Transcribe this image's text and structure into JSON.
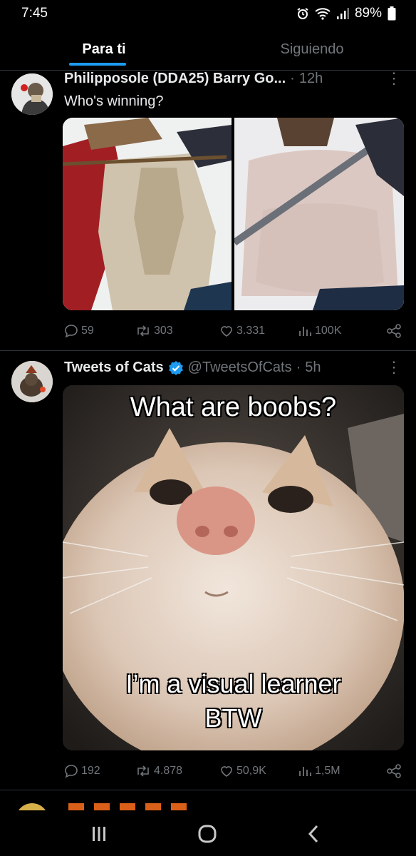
{
  "status_bar": {
    "time": "7:45",
    "battery": "89%",
    "icons": [
      "alarm-icon",
      "wifi-icon",
      "signal-icon",
      "battery-icon"
    ]
  },
  "tabs": [
    {
      "label": "Para ti",
      "active": true
    },
    {
      "label": "Siguiendo",
      "active": false
    }
  ],
  "tweets": [
    {
      "author": "Philipposole (DDA25) Barry Go...",
      "separator": "·",
      "time": "12h",
      "text": "Who's winning?",
      "replies": "59",
      "retweets": "303",
      "likes": "3.331",
      "views": "100K"
    },
    {
      "author": "Tweets of Cats",
      "verified": true,
      "handle": "@TweetsOfCats",
      "separator": "·",
      "time": "5h",
      "meme_top": "What are boobs?",
      "meme_bottom_1": "I’m a visual learner",
      "meme_bottom_2": "BTW",
      "replies": "192",
      "retweets": "4.878",
      "likes": "50,9K",
      "views": "1,5M"
    }
  ],
  "colors": {
    "accent": "#1d9bf0",
    "background": "#000000",
    "muted": "#71767b",
    "divider": "#2f3336"
  },
  "nav": [
    "recents-icon",
    "home-icon",
    "back-icon"
  ]
}
